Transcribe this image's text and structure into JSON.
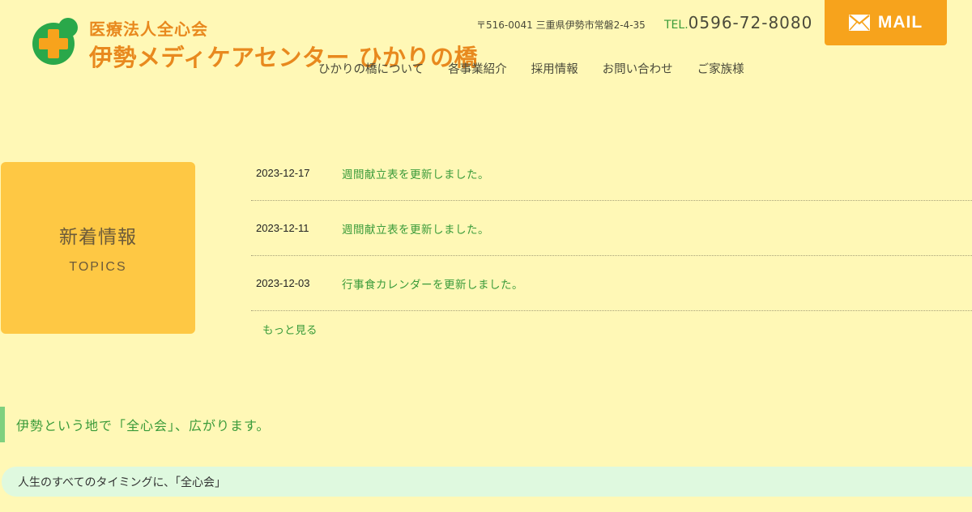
{
  "header": {
    "logo_sub": "医療法人全心会",
    "logo_main": "伊勢メディケアセンター ひかりの橋",
    "address": "〒516-0041 三重県伊勢市常磐2-4-35",
    "tel_label": "TEL.",
    "tel_number": "0596-72-8080",
    "mail_label": "MAIL"
  },
  "nav": {
    "items": [
      "ひかりの橋について",
      "各事業紹介",
      "採用情報",
      "お問い合わせ",
      "ご家族様"
    ]
  },
  "topics": {
    "title": "新着情報",
    "subtitle": "TOPICS",
    "items": [
      {
        "date": "2023-12-17",
        "text": "週間献立表を更新しました。"
      },
      {
        "date": "2023-12-11",
        "text": "週間献立表を更新しました。"
      },
      {
        "date": "2023-12-03",
        "text": "行事食カレンダーを更新しました。"
      }
    ],
    "more_label": "もっと見る"
  },
  "section": {
    "heading": "伊勢という地で「全心会」、広がります。",
    "subheading": "人生のすべてのタイミングに、「全心会」"
  },
  "colors": {
    "background": "#fff8b6",
    "brand_orange": "#e8891e",
    "mail_button": "#f7a31c",
    "topics_box": "#fec844",
    "link_green": "#3a9b3a",
    "logo_green": "#2aa84a",
    "logo_cross": "#f7a31c"
  },
  "icons": {
    "logo": "green-circle-orange-cross-logo",
    "mail": "envelope-icon"
  }
}
